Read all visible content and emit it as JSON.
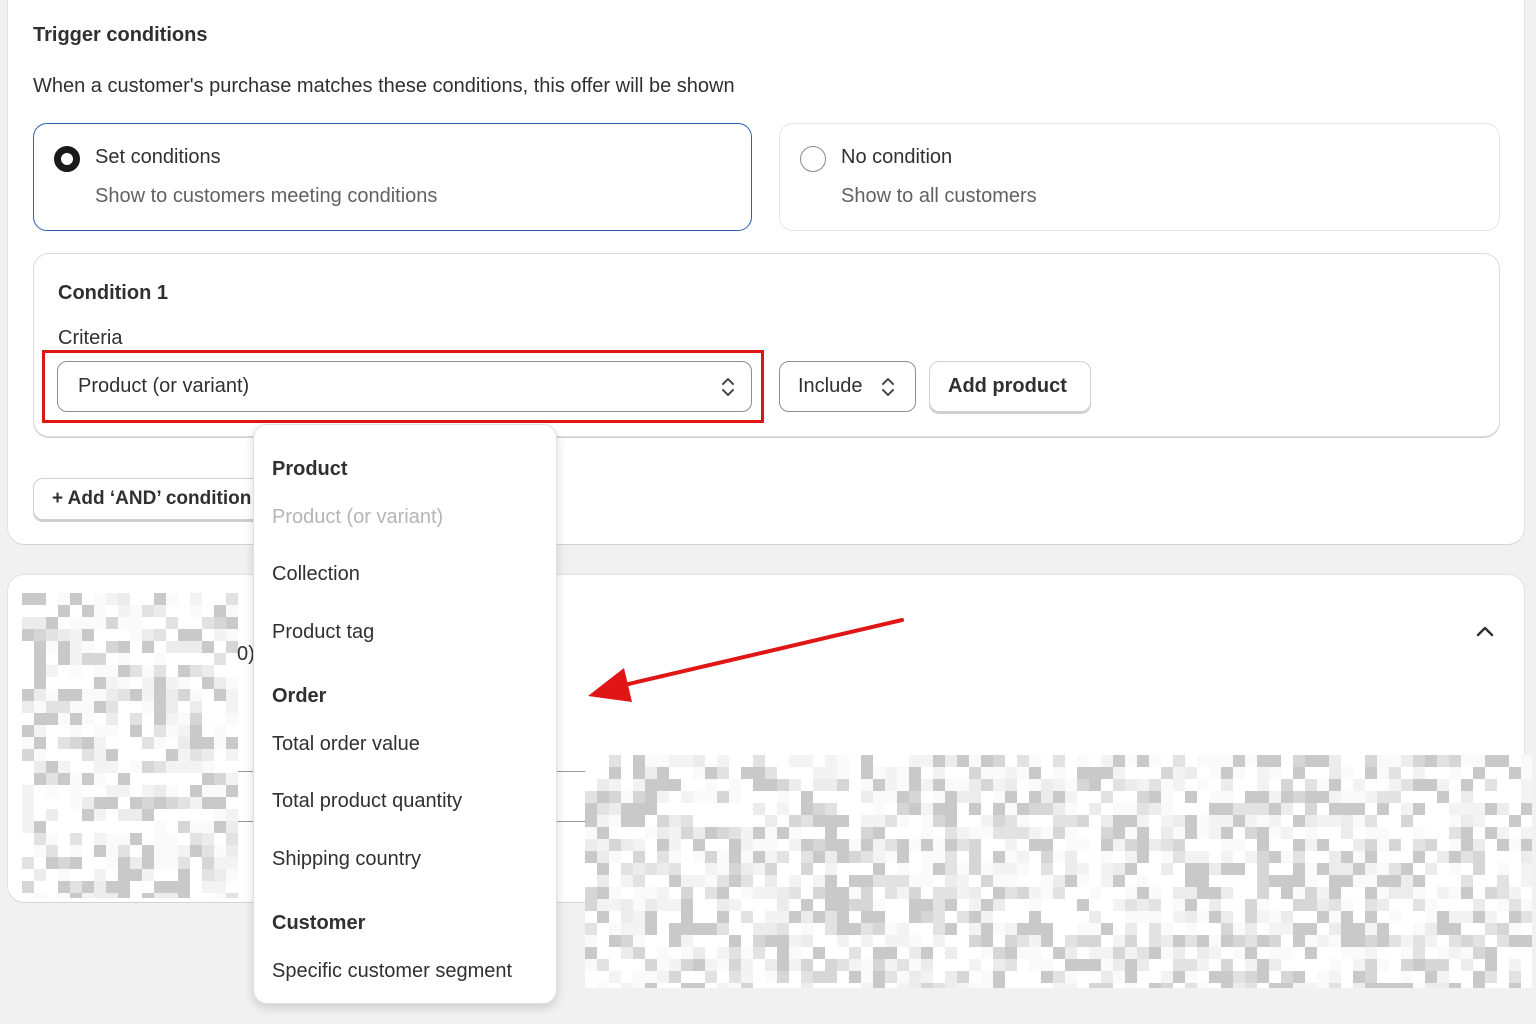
{
  "trigger": {
    "title": "Trigger conditions",
    "subtitle": "When a customer's purchase matches these conditions, this offer will be shown"
  },
  "options": {
    "set_conditions": {
      "title": "Set conditions",
      "description": "Show to customers meeting conditions",
      "selected": true
    },
    "no_condition": {
      "title": "No condition",
      "description": "Show to all customers",
      "selected": false
    }
  },
  "condition": {
    "title": "Condition 1",
    "criteria_label": "Criteria",
    "criteria_value": "Product (or variant)",
    "include_value": "Include",
    "add_product_label": "Add product"
  },
  "add_and_label": "+ Add ‘AND’ condition",
  "second_card": {
    "partial_text": "0)"
  },
  "dropdown": {
    "groups": [
      {
        "label": "Product",
        "items": [
          "Product (or variant)",
          "Collection",
          "Product tag"
        ],
        "disabled_index": 0
      },
      {
        "label": "Order",
        "items": [
          "Total order value",
          "Total product quantity",
          "Shipping country"
        ]
      },
      {
        "label": "Customer",
        "items": [
          "Specific customer segment"
        ]
      }
    ]
  },
  "colors": {
    "highlight": "#e01515",
    "selected_border": "#2a5fb4",
    "arrow": "#e01515"
  },
  "icons": {
    "select_caret": "up-down-chevron-icon",
    "collapse": "chevron-up-icon"
  }
}
